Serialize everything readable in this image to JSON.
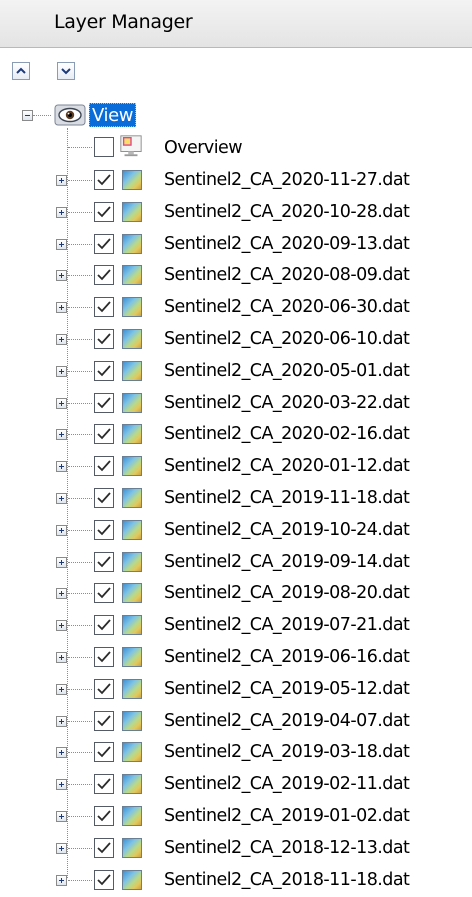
{
  "panel": {
    "title": "Layer Manager"
  },
  "toolbar": {
    "move_up_icon": "chevron-up-icon",
    "move_down_icon": "chevron-down-icon"
  },
  "tree": {
    "root": {
      "label": "View",
      "expanded": true,
      "selected": true,
      "icon": "eye-icon"
    },
    "overview": {
      "label": "Overview",
      "checked": false,
      "icon": "overview-icon"
    },
    "layers": [
      {
        "label": "Sentinel2_CA_2020-11-27.dat",
        "checked": true
      },
      {
        "label": "Sentinel2_CA_2020-10-28.dat",
        "checked": true
      },
      {
        "label": "Sentinel2_CA_2020-09-13.dat",
        "checked": true
      },
      {
        "label": "Sentinel2_CA_2020-08-09.dat",
        "checked": true
      },
      {
        "label": "Sentinel2_CA_2020-06-30.dat",
        "checked": true
      },
      {
        "label": "Sentinel2_CA_2020-06-10.dat",
        "checked": true
      },
      {
        "label": "Sentinel2_CA_2020-05-01.dat",
        "checked": true
      },
      {
        "label": "Sentinel2_CA_2020-03-22.dat",
        "checked": true
      },
      {
        "label": "Sentinel2_CA_2020-02-16.dat",
        "checked": true
      },
      {
        "label": "Sentinel2_CA_2020-01-12.dat",
        "checked": true
      },
      {
        "label": "Sentinel2_CA_2019-11-18.dat",
        "checked": true
      },
      {
        "label": "Sentinel2_CA_2019-10-24.dat",
        "checked": true
      },
      {
        "label": "Sentinel2_CA_2019-09-14.dat",
        "checked": true
      },
      {
        "label": "Sentinel2_CA_2019-08-20.dat",
        "checked": true
      },
      {
        "label": "Sentinel2_CA_2019-07-21.dat",
        "checked": true
      },
      {
        "label": "Sentinel2_CA_2019-06-16.dat",
        "checked": true
      },
      {
        "label": "Sentinel2_CA_2019-05-12.dat",
        "checked": true
      },
      {
        "label": "Sentinel2_CA_2019-04-07.dat",
        "checked": true
      },
      {
        "label": "Sentinel2_CA_2019-03-18.dat",
        "checked": true
      },
      {
        "label": "Sentinel2_CA_2019-02-11.dat",
        "checked": true
      },
      {
        "label": "Sentinel2_CA_2019-01-02.dat",
        "checked": true
      },
      {
        "label": "Sentinel2_CA_2018-12-13.dat",
        "checked": true
      },
      {
        "label": "Sentinel2_CA_2018-11-18.dat",
        "checked": true
      }
    ],
    "layer_icon": "raster-image-icon",
    "colors": {
      "selection": "#0a6cd8",
      "selection_text": "#ffffff",
      "tree_lines": "#8c8c8c"
    }
  }
}
